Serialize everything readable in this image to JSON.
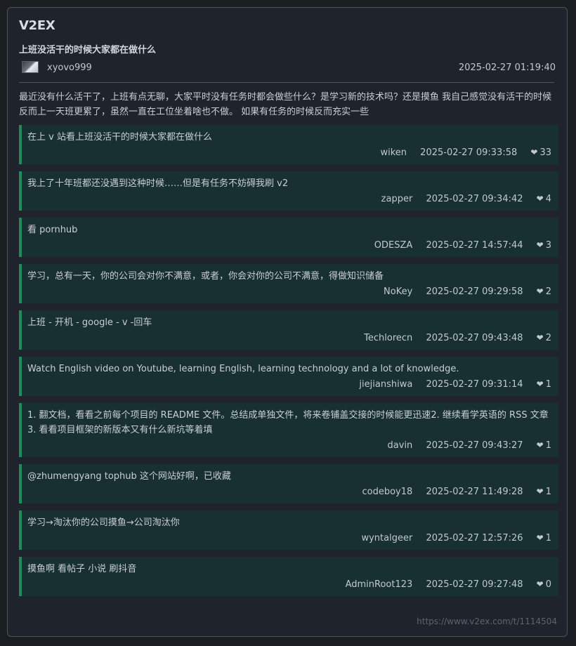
{
  "site": {
    "title": "V2EX"
  },
  "post": {
    "title": "上班没活干的时候大家都在做什么",
    "author": "xyovo999",
    "time": "2025-02-27 01:19:40",
    "content": "最近没有什么活干了，上班有点无聊，大家平时没有任务时都会做些什么？是学习新的技术吗？还是摸鱼 我自己感觉没有活干的时候反而上一天班更累了，虽然一直在工位坐着啥也不做。 如果有任务的时候反而充实一些"
  },
  "comments": [
    {
      "text": "在上 v 站看上班没活干的时候大家都在做什么",
      "user": "wiken",
      "time": "2025-02-27 09:33:58",
      "likes": "33"
    },
    {
      "text": "我上了十年班都还没遇到这种时候……但是有任务不妨碍我刷 v2",
      "user": "zapper",
      "time": "2025-02-27 09:34:42",
      "likes": "4"
    },
    {
      "text": "看 pornhub",
      "user": "ODESZA",
      "time": "2025-02-27 14:57:44",
      "likes": "3"
    },
    {
      "text": "学习，总有一天，你的公司会对你不满意，或者，你会对你的公司不满意，得做知识储备",
      "user": "NoKey",
      "time": "2025-02-27 09:29:58",
      "likes": "2"
    },
    {
      "text": "上班 - 开机 - google - v -回车",
      "user": "Techlorecn",
      "time": "2025-02-27 09:43:48",
      "likes": "2"
    },
    {
      "text": "Watch English video on Youtube, learning English, learning technology and a lot of knowledge.",
      "user": "jiejianshiwa",
      "time": "2025-02-27 09:31:14",
      "likes": "1"
    },
    {
      "text": "1. 翻文档，看看之前每个项目的 README 文件。总结成单独文件，将来卷铺盖交接的时候能更迅速2. 继续看学英语的 RSS 文章3. 看看项目框架的新版本又有什么新坑等着填",
      "user": "davin",
      "time": "2025-02-27 09:43:27",
      "likes": "1"
    },
    {
      "text": "@zhumengyang tophub 这个网站好啊，已收藏",
      "user": "codeboy18",
      "time": "2025-02-27 11:49:28",
      "likes": "1"
    },
    {
      "text": "学习→淘汰你的公司摸鱼→公司淘汰你",
      "user": "wyntalgeer",
      "time": "2025-02-27 12:57:26",
      "likes": "1"
    },
    {
      "text": "摸鱼啊 看帖子 小说 刷抖音",
      "user": "AdminRoot123",
      "time": "2025-02-27 09:27:48",
      "likes": "0"
    }
  ],
  "footer": {
    "url": "https://www.v2ex.com/t/1114504"
  },
  "icons": {
    "like": "heart-icon"
  },
  "colors": {
    "accent": "#1f8a5c",
    "comment_bg": "#18302f",
    "page_bg": "#1b1f24"
  }
}
